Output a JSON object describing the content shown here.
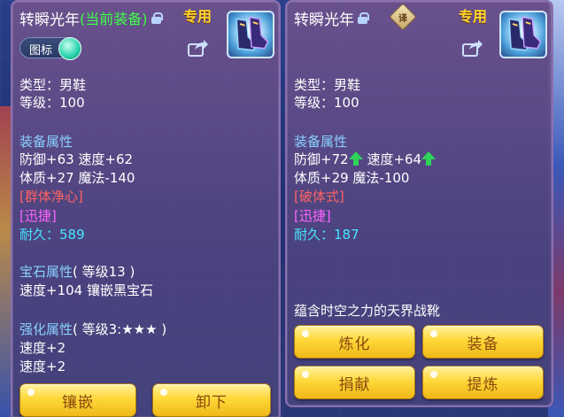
{
  "left": {
    "item_name": "转瞬光年",
    "equipped_tag": "(当前装备)",
    "exclusive": "专用",
    "toggle_label": "图标",
    "type_line": "类型：男鞋",
    "level_line": "等级：100",
    "attr_header": "装备属性",
    "attr_line1": "防御+63 速度+62",
    "attr_line2": "体质+27 魔法-140",
    "skill1": "[群体净心]",
    "skill2": "[迅捷]",
    "durability": "耐久：589",
    "gem_header": "宝石属性",
    "gem_level": "( 等级13 )",
    "gem_line": "速度+104 镶嵌黑宝石",
    "enhance_header": "强化属性",
    "enhance_level": "( 等级3:★★★ )",
    "enhance_line1": "速度+2",
    "enhance_line2": "速度+2",
    "btn_inlay": "镶嵌",
    "btn_unequip": "卸下"
  },
  "right": {
    "item_name": "转瞬光年",
    "compare_badge": "译",
    "exclusive": "专用",
    "type_line": "类型：男鞋",
    "level_line": "等级：100",
    "attr_header": "装备属性",
    "attr_def": "防御+72",
    "attr_spd": "速度+64",
    "attr_line2": "体质+29 魔法-100",
    "skill1": "[破体式]",
    "skill2": "[迅捷]",
    "durability": "耐久：187",
    "description": "蕴含时空之力的天界战靴",
    "btn_refine": "炼化",
    "btn_equip": "装备",
    "btn_donate": "捐献",
    "btn_extract": "提炼"
  },
  "icons": [
    "lock-icon",
    "share-icon",
    "boots-icon",
    "up-arrow-icon",
    "compare-icon",
    "toggle-switch"
  ],
  "colors": {
    "equipped": "#3cff48",
    "exclusive": "#ffd42a",
    "skill_red": "#ff6262",
    "skill_magenta": "#ff64ff",
    "durability": "#48e6ff",
    "header_blue": "#8ad0ff",
    "button_gold": "#ffd83a"
  }
}
